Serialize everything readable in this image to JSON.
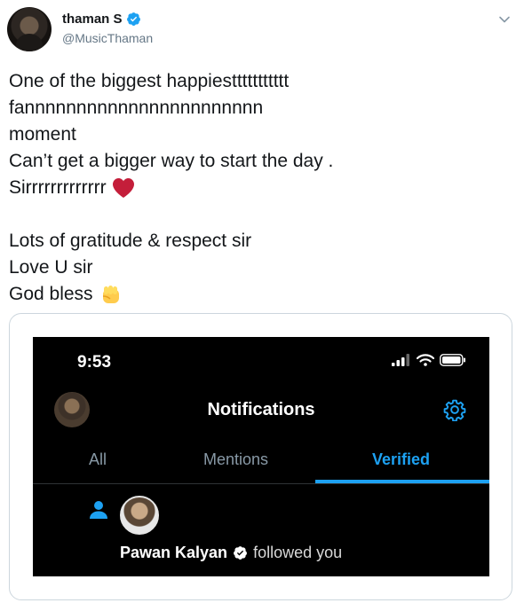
{
  "tweet": {
    "author": {
      "display_name": "thaman S",
      "handle": "@MusicThaman",
      "verified": true
    },
    "lines": [
      "One of the biggest happiesttttttttttt",
      "fannnnnnnnnnnnnnnnnnnnnnn",
      "moment",
      "Can’t get a bigger way to start the day .",
      "Sirrrrrrrrrrrrr",
      "",
      "Lots of gratitude & respect sir",
      "Love U sir",
      "God bless"
    ],
    "emojis": {
      "heart": "red-heart-icon",
      "fist": "raised-fist-icon"
    }
  },
  "screenshot": {
    "status_time": "9:53",
    "title": "Notifications",
    "tabs": [
      {
        "label": "All",
        "active": false
      },
      {
        "label": "Mentions",
        "active": false
      },
      {
        "label": "Verified",
        "active": true
      }
    ],
    "notification": {
      "name": "Pawan Kalyan",
      "action": "followed you",
      "verified": true
    }
  },
  "colors": {
    "accent": "#1da1f2",
    "text": "#14171a",
    "secondary": "#657786",
    "heart": "#e0245e"
  }
}
